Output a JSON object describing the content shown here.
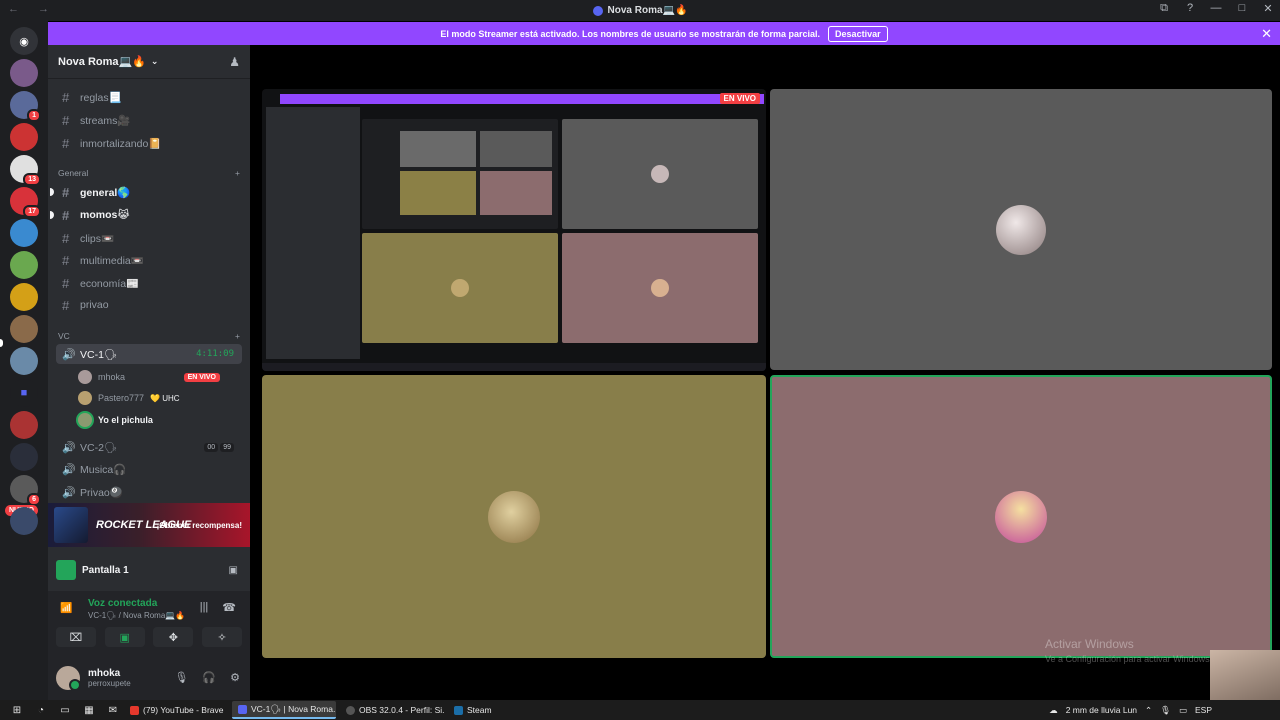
{
  "window": {
    "title": "Nova Roma💻🔥",
    "nav": "← →",
    "controls": [
      "⧉",
      "?",
      "—",
      "□",
      "✕"
    ]
  },
  "streamer_banner": {
    "text": "El modo Streamer está activado. Los nombres de usuario se mostrarán de forma parcial.",
    "button": "Desactivar",
    "close": "✕"
  },
  "servers": {
    "nuevo_label": "NUEVO",
    "badges": [
      "1",
      "13",
      "17",
      "6"
    ]
  },
  "sidebar": {
    "server_name": "Nova Roma💻🔥",
    "chevron": "⌄",
    "invite_icon": "♟",
    "top_channels": [
      {
        "name": "reglas📃"
      },
      {
        "name": "streams🎥"
      },
      {
        "name": "inmortalizando📔"
      }
    ],
    "category_general": "General",
    "general_channels": [
      {
        "name": "general🌎"
      },
      {
        "name": "momos😹"
      },
      {
        "name": "clips📼"
      },
      {
        "name": "multimedia📼"
      },
      {
        "name": "economía📰"
      },
      {
        "name": "privao"
      }
    ],
    "category_vc": "VC",
    "add": "+",
    "voice_active": {
      "name": "VC-1🗣",
      "time": "4:11:09"
    },
    "voice_users": [
      {
        "name": "mhoka",
        "live": "EN VIVO"
      },
      {
        "name": "Pastero777",
        "tag": "💛 UHC"
      },
      {
        "name": "Yo el pichula"
      }
    ],
    "voice_channels": [
      {
        "name": "VC-2🗣",
        "counts": [
          "00",
          "99"
        ]
      },
      {
        "name": "Musica🎧"
      },
      {
        "name": "Privao🎱"
      }
    ],
    "promo": {
      "logo": "ROCKET LEAGUE",
      "cta": "¡Obtener recompensa!"
    },
    "screen_share": {
      "label": "Pantalla 1"
    },
    "voice_status": {
      "title": "Voz conectada",
      "sub": "VC-1🗣 / Nova Roma💻🔥"
    },
    "user": {
      "name": "mhoka",
      "status": "perroxupete"
    }
  },
  "stage": {
    "live_tag": "EN VIVO"
  },
  "watermark": {
    "line1": "Activar Windows",
    "line2": "Ve a Configuración para activar Windows."
  },
  "taskbar": {
    "apps": [
      {
        "label": "(79) YouTube - Brave",
        "color": "#e5382c"
      },
      {
        "label": "VC-1🗣 | Nova Roma...",
        "color": "#5865f2",
        "active": true
      },
      {
        "label": "OBS 32.0.4 - Perfil: Si...",
        "color": "#302e31"
      },
      {
        "label": "Steam",
        "color": "#1b6ea8"
      }
    ],
    "weather": "2 mm de lluvia Lun",
    "lang": "ESP"
  }
}
